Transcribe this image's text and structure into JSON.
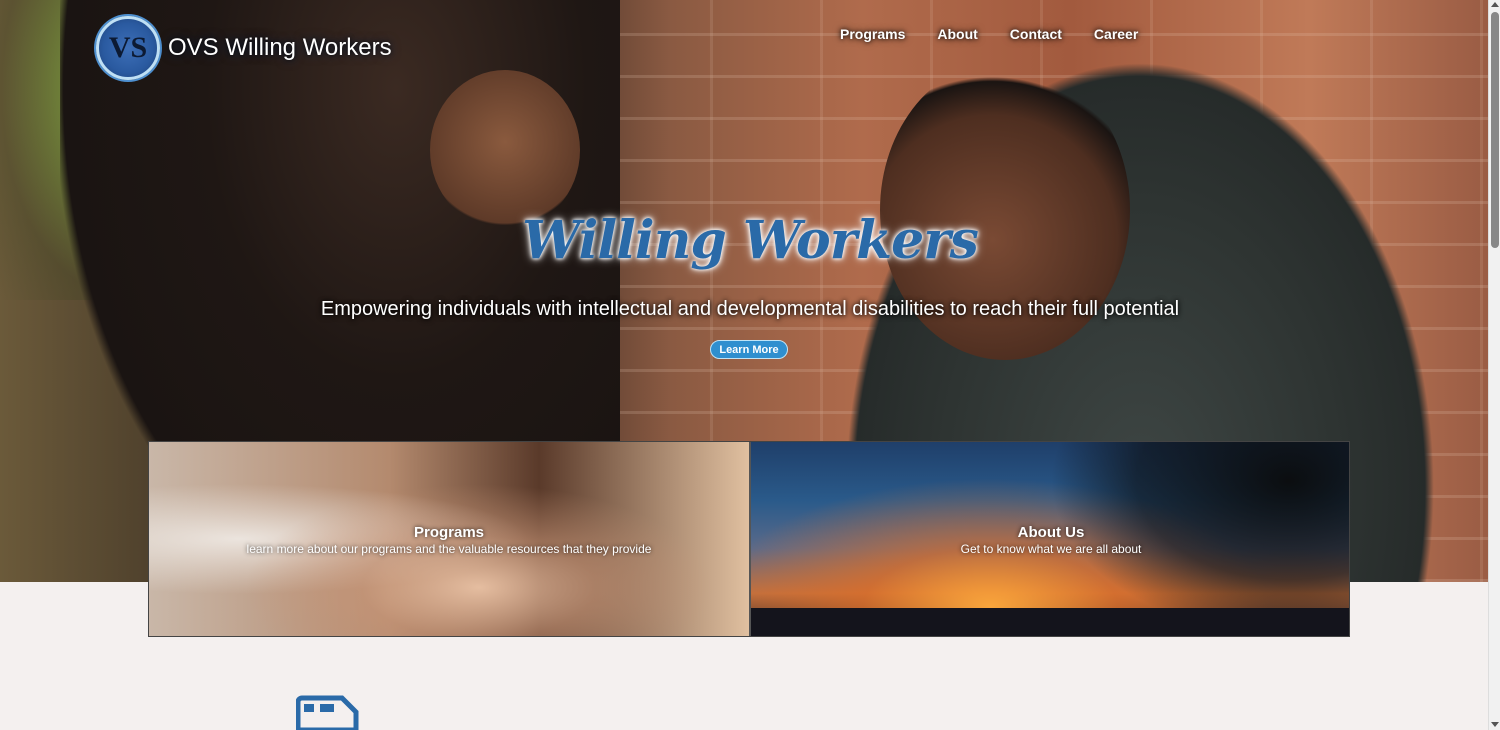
{
  "site": {
    "logo_mark": "VS",
    "logo_text": "OVS Willing Workers"
  },
  "nav": {
    "items": [
      {
        "label": "Programs"
      },
      {
        "label": "About"
      },
      {
        "label": "Contact"
      },
      {
        "label": "Career"
      }
    ]
  },
  "hero": {
    "script_title": "Willing Workers",
    "tagline": "Empowering individuals with intellectual and developmental disabilities to reach their full potential",
    "cta_label": "Learn More"
  },
  "cards": [
    {
      "title": "Programs",
      "subtitle": "learn more about our programs and the valuable resources that they provide"
    },
    {
      "title": "About Us",
      "subtitle": "Get to know what we are all about"
    }
  ],
  "icons": {
    "section_icon": "van-icon"
  },
  "colors": {
    "accent": "#2a6aa8",
    "button": "#2f8fcf",
    "page_bg": "#f4f0ef"
  }
}
